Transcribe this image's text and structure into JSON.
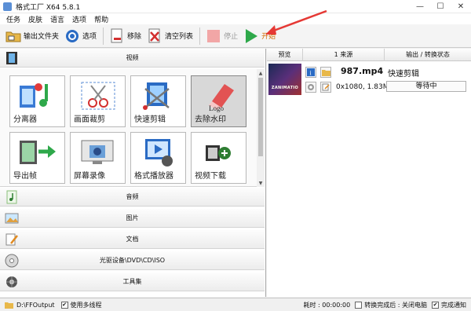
{
  "titlebar": {
    "title": "格式工厂 X64 5.8.1",
    "minimize": "—",
    "maximize": "☐",
    "close": "✕"
  },
  "menu": [
    "任务",
    "皮肤",
    "语言",
    "选项",
    "帮助"
  ],
  "toolbar": {
    "output_folder": "输出文件夹",
    "options": "选项",
    "remove": "移除",
    "clear_list": "清空列表",
    "stop": "停止",
    "start": "开始"
  },
  "categories": {
    "video": "视频",
    "audio": "音频",
    "image": "图片",
    "document": "文档",
    "disc": "光驱设备\\DVD\\CD\\ISO",
    "tools": "工具集"
  },
  "video_tools": [
    {
      "label": "分离器",
      "icon": "splitter-icon"
    },
    {
      "label": "画面裁剪",
      "icon": "crop-icon"
    },
    {
      "label": "快速剪辑",
      "icon": "quick-clip-icon"
    },
    {
      "label": "去除水印",
      "icon": "remove-watermark-icon",
      "selected": true
    },
    {
      "label": "导出帧",
      "icon": "export-frame-icon"
    },
    {
      "label": "屏幕录像",
      "icon": "screen-record-icon"
    },
    {
      "label": "格式播放器",
      "icon": "player-icon"
    },
    {
      "label": "视频下载",
      "icon": "video-download-icon"
    }
  ],
  "task_table": {
    "headers": [
      "预览",
      "1 来源",
      "输出 / 转换状态"
    ],
    "rows": [
      {
        "thumbnail_text": "ZANIMATIO",
        "filename": "987.mp4",
        "meta": "0x1080, 1.83M",
        "task": "快速剪辑",
        "status": "等待中"
      }
    ]
  },
  "statusbar": {
    "output_path": "D:\\FFOutput",
    "multithread": "使用多线程",
    "elapsed": "耗时 : 00:00:00",
    "after_convert": "转换完成后 : 关闭电脑",
    "notify": "完成通知"
  },
  "colors": {
    "accent": "#2e7d32",
    "arrow": "#e53935",
    "start_text": "#d26a00"
  }
}
